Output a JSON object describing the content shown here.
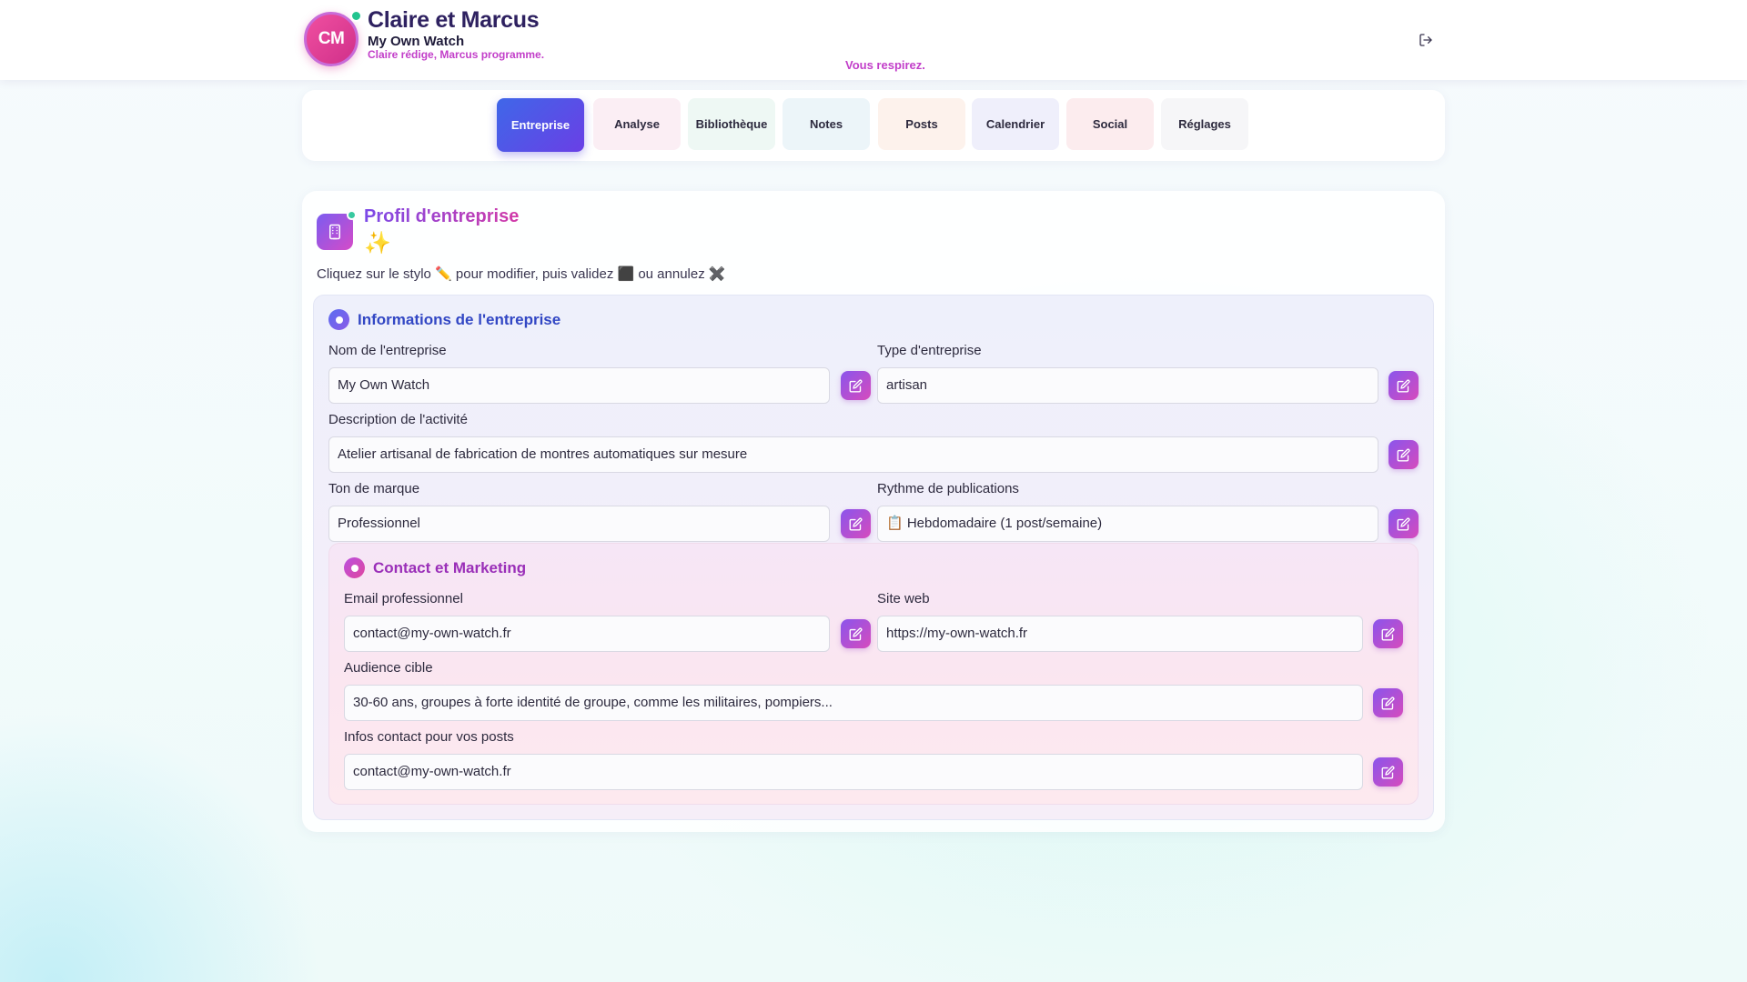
{
  "header": {
    "avatar_initials": "CM",
    "title": "Claire et Marcus",
    "subtitle": "My Own Watch",
    "tagline": "Claire rédige, Marcus programme.",
    "status_message": "Vous respirez.",
    "logout_icon": "logout-icon"
  },
  "tabs": [
    {
      "label": "Entreprise",
      "active": true,
      "color": "#4a5de6"
    },
    {
      "label": "Analyse",
      "active": false,
      "color": "#fbeef4"
    },
    {
      "label": "Bibliothèque",
      "active": false,
      "color": "#eef8f4"
    },
    {
      "label": "Notes",
      "active": false,
      "color": "#ecf5f9"
    },
    {
      "label": "Posts",
      "active": false,
      "color": "#fdf2ec"
    },
    {
      "label": "Calendrier",
      "active": false,
      "color": "#efeffb"
    },
    {
      "label": "Social",
      "active": false,
      "color": "#fcecee"
    },
    {
      "label": "Réglages",
      "active": false,
      "color": "#f6f6f8"
    }
  ],
  "profile": {
    "title": "Profil d'entreprise",
    "sparkle": "✨",
    "hint": "Cliquez sur le stylo ✏️ pour modifier, puis validez ⬛ ou annulez ✖️"
  },
  "info_section": {
    "title": "Informations de l'entreprise",
    "fields": {
      "company_name": {
        "label": "Nom de l'entreprise",
        "value": "My Own Watch"
      },
      "company_type": {
        "label": "Type d'entreprise",
        "value": "artisan"
      },
      "description": {
        "label": "Description de l'activité",
        "value": "Atelier artisanal de fabrication de montres automatiques sur mesure"
      },
      "brand_tone": {
        "label": "Ton de marque",
        "value": "Professionnel"
      },
      "publication_rhythm": {
        "label": "Rythme de publications",
        "value": "📋 Hebdomadaire (1 post/semaine)"
      }
    }
  },
  "contact_section": {
    "title": "Contact et Marketing",
    "fields": {
      "email": {
        "label": "Email professionnel",
        "value": "contact@my-own-watch.fr"
      },
      "website": {
        "label": "Site web",
        "value": "https://my-own-watch.fr"
      },
      "audience": {
        "label": "Audience cible",
        "value": "30-60 ans, groupes à forte identité de groupe, comme les militaires, pompiers..."
      },
      "post_contact": {
        "label": "Infos contact pour vos posts",
        "value": "contact@my-own-watch.fr"
      }
    }
  },
  "colors": {
    "accent": "#6a3fe6",
    "brand_pink": "#c23ec9",
    "online": "#22c48f"
  }
}
